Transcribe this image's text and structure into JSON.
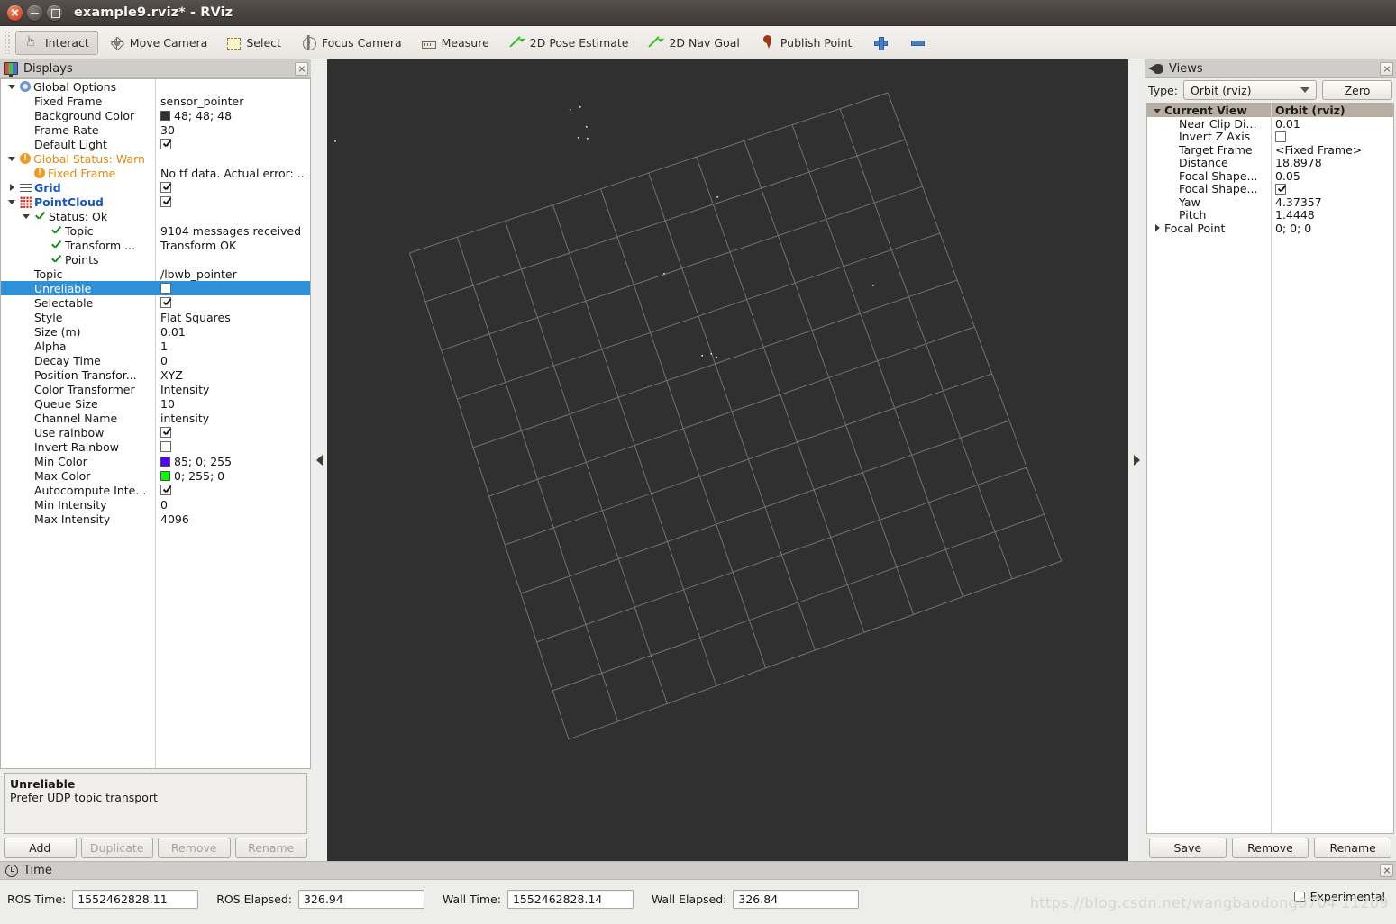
{
  "window": {
    "title": "example9.rviz* - RViz",
    "buttons": {
      "close": "close-button",
      "minimize": "minimize-button",
      "maximize": "maximize-button"
    }
  },
  "toolbar": {
    "items": [
      {
        "label": "Interact",
        "icon": "hand-icon",
        "active": true
      },
      {
        "label": "Move Camera",
        "icon": "move-camera-icon",
        "active": false
      },
      {
        "label": "Select",
        "icon": "select-icon",
        "active": false
      },
      {
        "label": "Focus Camera",
        "icon": "focus-camera-icon",
        "active": false
      },
      {
        "label": "Measure",
        "icon": "ruler-icon",
        "active": false
      },
      {
        "label": "2D Pose Estimate",
        "icon": "arrow-icon",
        "active": false
      },
      {
        "label": "2D Nav Goal",
        "icon": "arrow-icon",
        "active": false
      },
      {
        "label": "Publish Point",
        "icon": "map-pin-icon",
        "active": false
      }
    ],
    "add_tool_icon": "plus-icon",
    "remove_tool_icon": "minus-icon"
  },
  "displays": {
    "title": "Displays",
    "icon": "monitor-icon",
    "close_icon": "close-icon",
    "rows": [
      {
        "indent": 0,
        "arrow": "down",
        "icon": "gear-icon",
        "name": "Global Options",
        "style": "plain",
        "value": "",
        "vtype": "text"
      },
      {
        "indent": 1,
        "arrow": "none",
        "icon": "none",
        "name": "Fixed Frame",
        "style": "plain",
        "value": "sensor_pointer",
        "vtype": "text"
      },
      {
        "indent": 1,
        "arrow": "none",
        "icon": "none",
        "name": "Background Color",
        "style": "plain",
        "value": "48; 48; 48",
        "vtype": "color",
        "color": "#303030"
      },
      {
        "indent": 1,
        "arrow": "none",
        "icon": "none",
        "name": "Frame Rate",
        "style": "plain",
        "value": "30",
        "vtype": "text"
      },
      {
        "indent": 1,
        "arrow": "none",
        "icon": "none",
        "name": "Default Light",
        "style": "plain",
        "value": "",
        "vtype": "checked"
      },
      {
        "indent": 0,
        "arrow": "down",
        "icon": "warn-icon",
        "name": "Global Status: Warn",
        "style": "warn",
        "value": "",
        "vtype": "text"
      },
      {
        "indent": 1,
        "arrow": "none",
        "icon": "warn-icon",
        "name": "Fixed Frame",
        "style": "warn",
        "value": "No tf data.  Actual error: ...",
        "vtype": "text"
      },
      {
        "indent": 0,
        "arrow": "right",
        "icon": "grid-icon",
        "name": "Grid",
        "style": "blue",
        "value": "",
        "vtype": "checked"
      },
      {
        "indent": 0,
        "arrow": "down",
        "icon": "pointcloud-icon",
        "name": "PointCloud",
        "style": "blue",
        "value": "",
        "vtype": "checked"
      },
      {
        "indent": 1,
        "arrow": "down",
        "icon": "check-icon",
        "name": "Status: Ok",
        "style": "plain",
        "value": "",
        "vtype": "text"
      },
      {
        "indent": 2,
        "arrow": "none",
        "icon": "check-icon",
        "name": "Topic",
        "style": "plain",
        "value": "9104 messages received",
        "vtype": "text"
      },
      {
        "indent": 2,
        "arrow": "none",
        "icon": "check-icon",
        "name": "Transform ...",
        "style": "plain",
        "value": "Transform OK",
        "vtype": "text"
      },
      {
        "indent": 2,
        "arrow": "none",
        "icon": "check-icon",
        "name": "Points",
        "style": "plain",
        "value": "",
        "vtype": "text"
      },
      {
        "indent": 1,
        "arrow": "none",
        "icon": "none",
        "name": "Topic",
        "style": "plain",
        "value": "/lbwb_pointer",
        "vtype": "text"
      },
      {
        "indent": 1,
        "arrow": "none",
        "icon": "none",
        "name": "Unreliable",
        "style": "plain",
        "value": "",
        "vtype": "unchecked",
        "selected": true
      },
      {
        "indent": 1,
        "arrow": "none",
        "icon": "none",
        "name": "Selectable",
        "style": "plain",
        "value": "",
        "vtype": "checked"
      },
      {
        "indent": 1,
        "arrow": "none",
        "icon": "none",
        "name": "Style",
        "style": "plain",
        "value": "Flat Squares",
        "vtype": "text"
      },
      {
        "indent": 1,
        "arrow": "none",
        "icon": "none",
        "name": "Size (m)",
        "style": "plain",
        "value": "0.01",
        "vtype": "text"
      },
      {
        "indent": 1,
        "arrow": "none",
        "icon": "none",
        "name": "Alpha",
        "style": "plain",
        "value": "1",
        "vtype": "text"
      },
      {
        "indent": 1,
        "arrow": "none",
        "icon": "none",
        "name": "Decay Time",
        "style": "plain",
        "value": "0",
        "vtype": "text"
      },
      {
        "indent": 1,
        "arrow": "none",
        "icon": "none",
        "name": "Position Transfor...",
        "style": "plain",
        "value": "XYZ",
        "vtype": "text"
      },
      {
        "indent": 1,
        "arrow": "none",
        "icon": "none",
        "name": "Color Transformer",
        "style": "plain",
        "value": "Intensity",
        "vtype": "text"
      },
      {
        "indent": 1,
        "arrow": "none",
        "icon": "none",
        "name": "Queue Size",
        "style": "plain",
        "value": "10",
        "vtype": "text"
      },
      {
        "indent": 1,
        "arrow": "none",
        "icon": "none",
        "name": "Channel Name",
        "style": "plain",
        "value": "intensity",
        "vtype": "text"
      },
      {
        "indent": 1,
        "arrow": "none",
        "icon": "none",
        "name": "Use rainbow",
        "style": "plain",
        "value": "",
        "vtype": "checked"
      },
      {
        "indent": 1,
        "arrow": "none",
        "icon": "none",
        "name": "Invert Rainbow",
        "style": "plain",
        "value": "",
        "vtype": "unchecked"
      },
      {
        "indent": 1,
        "arrow": "none",
        "icon": "none",
        "name": "Min Color",
        "style": "plain",
        "value": "85; 0; 255",
        "vtype": "color",
        "color": "#5500ff"
      },
      {
        "indent": 1,
        "arrow": "none",
        "icon": "none",
        "name": "Max Color",
        "style": "plain",
        "value": "0; 255; 0",
        "vtype": "color",
        "color": "#00ff00"
      },
      {
        "indent": 1,
        "arrow": "none",
        "icon": "none",
        "name": "Autocompute Inte...",
        "style": "plain",
        "value": "",
        "vtype": "checked"
      },
      {
        "indent": 1,
        "arrow": "none",
        "icon": "none",
        "name": "Min Intensity",
        "style": "plain",
        "value": "0",
        "vtype": "text"
      },
      {
        "indent": 1,
        "arrow": "none",
        "icon": "none",
        "name": "Max Intensity",
        "style": "plain",
        "value": "4096",
        "vtype": "text"
      }
    ],
    "help": {
      "title": "Unreliable",
      "description": "Prefer UDP topic transport"
    },
    "buttons": [
      {
        "label": "Add",
        "enabled": true
      },
      {
        "label": "Duplicate",
        "enabled": false
      },
      {
        "label": "Remove",
        "enabled": false
      },
      {
        "label": "Rename",
        "enabled": false
      }
    ]
  },
  "views": {
    "title": "Views",
    "icon": "views-icon",
    "close_icon": "close-icon",
    "type_label": "Type:",
    "type_value": "Orbit (rviz)",
    "zero_label": "Zero",
    "header": {
      "name": "Current View",
      "value": "Orbit (rviz)"
    },
    "rows": [
      {
        "indent": 1,
        "arrow": "none",
        "name": "Near Clip Di...",
        "value": "0.01",
        "vtype": "text"
      },
      {
        "indent": 1,
        "arrow": "none",
        "name": "Invert Z Axis",
        "value": "",
        "vtype": "unchecked"
      },
      {
        "indent": 1,
        "arrow": "none",
        "name": "Target Frame",
        "value": "<Fixed Frame>",
        "vtype": "text"
      },
      {
        "indent": 1,
        "arrow": "none",
        "name": "Distance",
        "value": "18.8978",
        "vtype": "text"
      },
      {
        "indent": 1,
        "arrow": "none",
        "name": "Focal Shape...",
        "value": "0.05",
        "vtype": "text"
      },
      {
        "indent": 1,
        "arrow": "none",
        "name": "Focal Shape...",
        "value": "",
        "vtype": "checked"
      },
      {
        "indent": 1,
        "arrow": "none",
        "name": "Yaw",
        "value": "4.37357",
        "vtype": "text"
      },
      {
        "indent": 1,
        "arrow": "none",
        "name": "Pitch",
        "value": "1.4448",
        "vtype": "text"
      },
      {
        "indent": 0,
        "arrow": "right",
        "name": "Focal Point",
        "value": "0; 0; 0",
        "vtype": "text"
      }
    ],
    "buttons": [
      {
        "label": "Save"
      },
      {
        "label": "Remove"
      },
      {
        "label": "Rename"
      }
    ]
  },
  "viewport": {
    "background_color": "#303030",
    "grid_color": "#9a9a9a",
    "grid_cells": 10,
    "point_color": "#e8e8e8",
    "collapse_left_icon": "collapse-left-arrow",
    "collapse_right_icon": "collapse-right-arrow"
  },
  "time": {
    "title": "Time",
    "icon": "clock-icon",
    "close_icon": "close-icon",
    "fields": [
      {
        "label": "ROS Time:",
        "value": "1552462828.11"
      },
      {
        "label": "ROS Elapsed:",
        "value": "326.94"
      },
      {
        "label": "Wall Time:",
        "value": "1552462828.14"
      },
      {
        "label": "Wall Elapsed:",
        "value": "326.84"
      }
    ],
    "experimental_label": "Experimental"
  },
  "watermark": "https://blog.csdn.net/wangbaodong0704 11209"
}
